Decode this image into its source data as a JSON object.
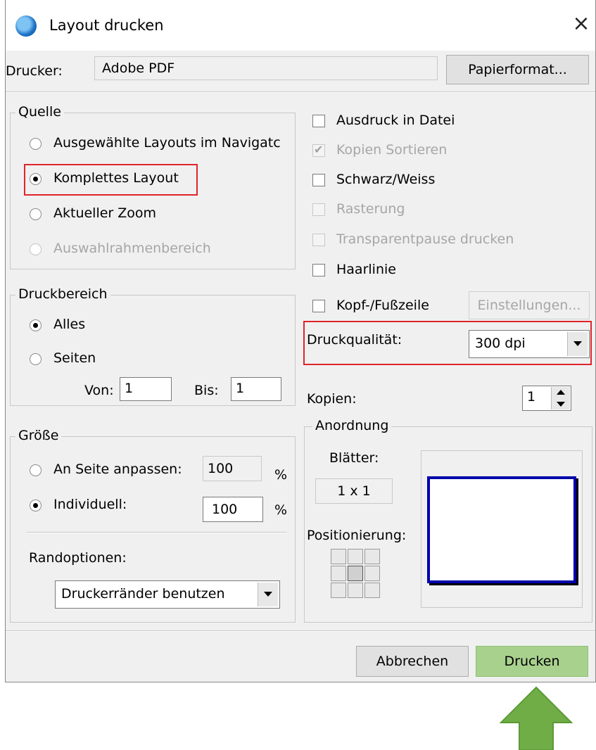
{
  "window": {
    "title": "Layout drucken",
    "close_label": "×"
  },
  "printer": {
    "label": "Drucker:",
    "value": "Adobe PDF",
    "paper_button": "Papierformat..."
  },
  "source": {
    "legend": "Quelle",
    "options": [
      {
        "label": "Ausgewählte Layouts im Navigatc",
        "checked": false,
        "disabled": false
      },
      {
        "label": "Komplettes Layout",
        "checked": true,
        "disabled": false
      },
      {
        "label": "Aktueller Zoom",
        "checked": false,
        "disabled": false
      },
      {
        "label": "Auswahlrahmenbereich",
        "checked": false,
        "disabled": true
      }
    ]
  },
  "options": {
    "print_to_file": "Ausdruck in Datei",
    "collate": "Kopien Sortieren",
    "black_white": "Schwarz/Weiss",
    "raster": "Rasterung",
    "transparent": "Transparentpause drucken",
    "hairline": "Haarlinie",
    "header_footer": "Kopf-/Fußzeile",
    "settings_button": "Einstellungen..."
  },
  "quality": {
    "label": "Druckqualität:",
    "value": "300 dpi"
  },
  "copies": {
    "label": "Kopien:",
    "value": "1"
  },
  "range": {
    "legend": "Druckbereich",
    "all": "Alles",
    "pages": "Seiten",
    "from_label": "Von:",
    "from_value": "1",
    "to_label": "Bis:",
    "to_value": "1"
  },
  "arrangement": {
    "legend": "Anordnung",
    "sheets_label": "Blätter:",
    "sheets_value": "1 x 1",
    "positioning_label": "Positionierung:"
  },
  "size": {
    "legend": "Größe",
    "fit_label": "An Seite anpassen:",
    "fit_value": "100",
    "custom_label": "Individuell:",
    "custom_value": "100",
    "percent": "%",
    "margins_label": "Randoptionen:",
    "margins_value": "Druckerränder benutzen"
  },
  "footer": {
    "cancel": "Abbrechen",
    "print": "Drucken"
  },
  "colors": {
    "highlight_red": "#e0242a",
    "print_green": "#a9d18e",
    "arrow_green": "#70ad47",
    "preview_border": "#0000aa"
  }
}
